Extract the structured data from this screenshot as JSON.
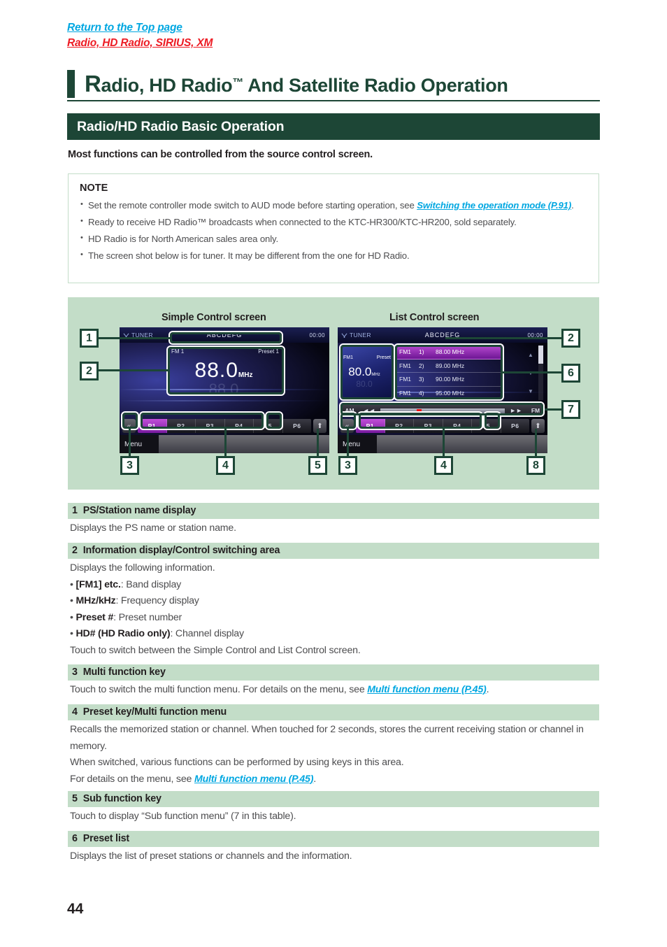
{
  "top_links": {
    "return": "Return to the Top page",
    "breadcrumb": "Radio, HD Radio, SIRIUS, XM"
  },
  "chapter": {
    "initial": "R",
    "rest": "adio, HD Radio",
    "tm": "™",
    "tail": " And Satellite Radio Operation"
  },
  "banner": {
    "title": "Radio/HD Radio Basic Operation"
  },
  "intro": "Most functions can be controlled from the source control screen.",
  "note": {
    "title": "NOTE",
    "items": [
      {
        "pre": "Set the remote controller mode switch to AUD mode before starting operation, see ",
        "link": "Switching the operation mode (P.91)",
        "post": "."
      },
      {
        "pre": "Ready to receive HD Radio™ broadcasts when connected to the KTC-HR300/KTC-HR200, sold separately.",
        "link": "",
        "post": ""
      },
      {
        "pre": "HD Radio is for North American sales area only.",
        "link": "",
        "post": ""
      },
      {
        "pre": "The screen shot below is for tuner. It may be different from the one for HD Radio.",
        "link": "",
        "post": ""
      }
    ]
  },
  "figure": {
    "caption_simple": "Simple Control screen",
    "caption_list": "List Control screen",
    "simple_screen": {
      "source_tag": "TUNER",
      "ps_name": "ABCDEFG",
      "clock": "00:00",
      "band": "FM 1",
      "preset": "Preset 1",
      "frequency": "88.0",
      "unit": "MHz",
      "ghost": "88.0",
      "left_arrow": "«",
      "sub_arrow": "⬆",
      "preset_keys": [
        "P1",
        "P2",
        "P3",
        "P4",
        "P5",
        "P6"
      ],
      "menu_label": "Menu"
    },
    "list_screen": {
      "source_tag": "TUNER",
      "ps_name": "ABCDEFG",
      "clock": "00:00",
      "mini_band": "FM1",
      "mini_preset": "Preset",
      "mini_frequency": "80.0",
      "mini_unit": "MHz",
      "preset_list": [
        {
          "band": "FM1",
          "index": "1)",
          "freq": "88.00 MHz"
        },
        {
          "band": "FM1",
          "index": "2)",
          "freq": "89.00 MHz"
        },
        {
          "band": "FM1",
          "index": "3)",
          "freq": "90.00 MHz"
        },
        {
          "band": "FM1",
          "index": "4)",
          "freq": "95.00 MHz"
        }
      ],
      "seek_left_label": "AM",
      "seek_left_arrow": "◄◄",
      "seek_right_arrow": "►►",
      "seek_right_label": "FM",
      "left_arrow": "«",
      "sub_arrow": "⬆",
      "preset_keys": [
        "P1",
        "P2",
        "P3",
        "P4",
        "P5",
        "P6"
      ],
      "menu_label": "Menu"
    },
    "callouts": {
      "c1": "1",
      "c2a": "2",
      "c3a": "3",
      "c4a": "4",
      "c5": "5",
      "c2b": "2",
      "c6": "6",
      "c7": "7",
      "c3b": "3",
      "c4b": "4",
      "c8": "8"
    }
  },
  "sections": [
    {
      "num": "1",
      "title": "PS/Station name display",
      "lines": [
        {
          "type": "text",
          "text": "Displays the PS name or station name."
        }
      ]
    },
    {
      "num": "2",
      "title": "Information display/Control switching area",
      "lines": [
        {
          "type": "text",
          "text": "Displays the following information."
        },
        {
          "type": "bullet",
          "bold": "[FM1] etc.",
          "text": ": Band display"
        },
        {
          "type": "bullet",
          "bold": "MHz/kHz",
          "text": ": Frequency display"
        },
        {
          "type": "bullet",
          "bold": "Preset #",
          "text": ": Preset number"
        },
        {
          "type": "bullet",
          "bold": "HD# (HD Radio only)",
          "text": ": Channel display"
        },
        {
          "type": "text",
          "text": "Touch to switch between the Simple Control and List Control screen."
        }
      ]
    },
    {
      "num": "3",
      "title": "Multi function key",
      "lines": [
        {
          "type": "link",
          "pre": "Touch to switch the multi function menu. For details on the menu, see ",
          "link": "Multi function menu (P.45)",
          "post": "."
        }
      ]
    },
    {
      "num": "4",
      "title": "Preset key/Multi function menu",
      "lines": [
        {
          "type": "text",
          "text": "Recalls the memorized station or channel. When touched for 2 seconds, stores the current receiving station or channel in memory."
        },
        {
          "type": "text",
          "text": "When switched, various functions can be performed by using keys in this area."
        },
        {
          "type": "link",
          "pre": "For details on the menu, see ",
          "link": "Multi function menu (P.45)",
          "post": "."
        }
      ]
    },
    {
      "num": "5",
      "title": "Sub function key",
      "lines": [
        {
          "type": "text",
          "text": "Touch to display “Sub function menu” (7 in this table)."
        }
      ]
    },
    {
      "num": "6",
      "title": "Preset list",
      "lines": [
        {
          "type": "text",
          "text": "Displays the list of preset stations or channels and the information."
        }
      ]
    }
  ],
  "page_number": "44"
}
